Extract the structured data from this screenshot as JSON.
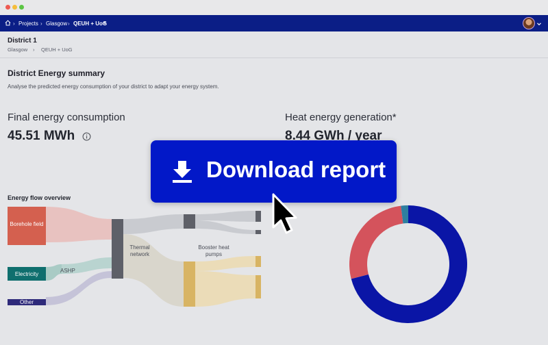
{
  "nav": {
    "breadcrumb": [
      "Projects",
      "Glasgow",
      "QEUH + UoG"
    ]
  },
  "header": {
    "title": "District 1",
    "breadcrumb": [
      "Glasgow",
      "QEUH + UoG"
    ]
  },
  "summary": {
    "title": "District Energy summary",
    "description": "Analyse the predicted energy consumption of your district to adapt your energy system."
  },
  "kpis": {
    "consumption_label": "Final energy consumption",
    "consumption_value": "45.51 MWh",
    "generation_label": "Heat energy generation*",
    "generation_value": "8.44 GWh / year"
  },
  "flow": {
    "title": "Energy flow overview",
    "nodes": {
      "borehole": "Borehole field",
      "electricity": "Electricity",
      "other": "Other",
      "ashp": "ASHP",
      "thermal": "Thermal network",
      "booster": "Booster heat pumps"
    }
  },
  "chart_data": {
    "type": "pie",
    "title": "",
    "slices": [
      {
        "label": "",
        "value": 71,
        "color": "#0a15a6"
      },
      {
        "label": "",
        "value": 27,
        "color": "#d4535c"
      },
      {
        "label": "",
        "value": 2,
        "color": "#2e7fa0"
      }
    ]
  },
  "cta": {
    "label": "Download report"
  },
  "colors": {
    "navbar": "#0b1e86",
    "cta": "#0218c8",
    "borehole": "#d4604f",
    "electricity": "#0f6f6e",
    "other": "#2e2a7a",
    "thermal": "#5e6068",
    "booster": "#d8b463"
  }
}
